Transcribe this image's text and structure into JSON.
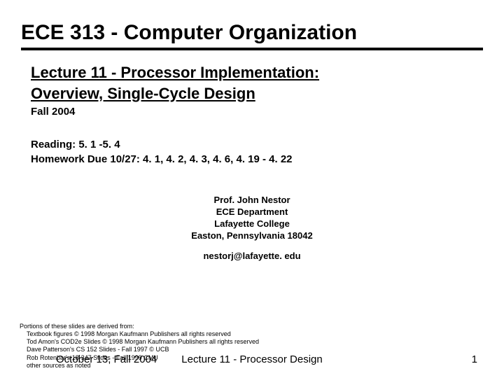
{
  "title": "ECE 313 - Computer Organization",
  "subtitle_line1": "Lecture 11 - Processor Implementation:",
  "subtitle_line2": "Overview, Single-Cycle Design",
  "term": "Fall 2004",
  "reading": "Reading: 5. 1 -5. 4",
  "homework": "Homework Due 10/27: 4. 1, 4. 2, 4. 3, 4. 6, 4. 19 - 4. 22",
  "prof": {
    "name": "Prof. John Nestor",
    "dept": "ECE Department",
    "college": "Lafayette College",
    "addr": "Easton, Pennsylvania 18042",
    "email": "nestorj@lafayette. edu"
  },
  "credits": {
    "l1": "Portions of these slides are derived from:",
    "l2": "Textbook figures © 1998 Morgan Kaufmann Publishers all rights reserved",
    "l3": "Tod Amon's COD2e Slides © 1998 Morgan Kaufmann Publishers all rights reserved",
    "l4": "Dave Patterson's CS 152 Slides - Fall 1997 © UCB",
    "l5": "Rob Rotenbar's 18-347 Slides - Fall 1999 CMU",
    "l6": "other sources as noted"
  },
  "footer": {
    "date_overlap": "October 13, Fall 2004",
    "center": "Lecture 11 - Processor Design",
    "page": "1"
  }
}
